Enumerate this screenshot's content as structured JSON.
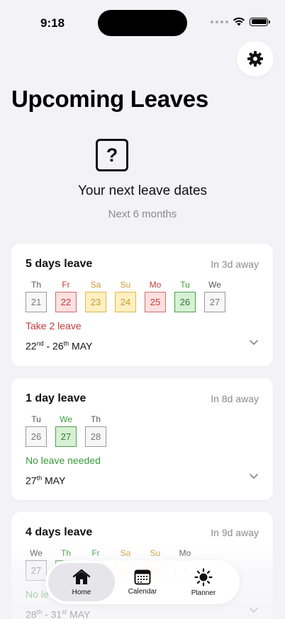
{
  "status": {
    "time": "9:18"
  },
  "header": {
    "title": "Upcoming Leaves",
    "settings_icon": "gear-icon"
  },
  "hero": {
    "icon": "question-square-icon",
    "icon_glyph": "?",
    "title": "Your next leave dates",
    "subtitle": "Next 6 months"
  },
  "cards": [
    {
      "title": "5 days leave",
      "away": "In 3d away",
      "days": [
        {
          "name": "Th",
          "num": "21",
          "state": "normal"
        },
        {
          "name": "Fr",
          "num": "22",
          "state": "leave"
        },
        {
          "name": "Sa",
          "num": "23",
          "state": "weekend"
        },
        {
          "name": "Su",
          "num": "24",
          "state": "weekend"
        },
        {
          "name": "Mo",
          "num": "25",
          "state": "leave"
        },
        {
          "name": "Tu",
          "num": "26",
          "state": "holiday"
        },
        {
          "name": "We",
          "num": "27",
          "state": "normal"
        }
      ],
      "note": "Take 2 leave",
      "note_kind": "red",
      "range_start_day": "22",
      "range_start_suffix": "nd",
      "range_sep": " - ",
      "range_end_day": "26",
      "range_end_suffix": "th",
      "range_month": " MAY"
    },
    {
      "title": "1 day leave",
      "away": "In 8d away",
      "days": [
        {
          "name": "Tu",
          "num": "26",
          "state": "normal"
        },
        {
          "name": "We",
          "num": "27",
          "state": "holiday"
        },
        {
          "name": "Th",
          "num": "28",
          "state": "normal"
        }
      ],
      "note": "No leave needed",
      "note_kind": "green",
      "range_start_day": "27",
      "range_start_suffix": "th",
      "range_month": " MAY"
    },
    {
      "title": "4 days leave",
      "away": "In 9d away",
      "days": [
        {
          "name": "We",
          "num": "27",
          "state": "normal"
        },
        {
          "name": "Th",
          "num": "28",
          "state": "holiday"
        },
        {
          "name": "Fr",
          "num": "29",
          "state": "holiday"
        },
        {
          "name": "Sa",
          "num": "30",
          "state": "weekend"
        },
        {
          "name": "Su",
          "num": "31",
          "state": "weekend"
        },
        {
          "name": "Mo",
          "num": "1",
          "state": "normal"
        }
      ],
      "note": "No le",
      "note_kind": "green",
      "range_start_day": "28",
      "range_start_suffix": "th",
      "range_sep": " - ",
      "range_end_day": "31",
      "range_end_suffix": "st",
      "range_month": " MAY"
    }
  ],
  "tabbar": {
    "tabs": [
      {
        "label": "Home",
        "icon": "house-icon",
        "selected": true
      },
      {
        "label": "Calendar",
        "icon": "calendar-icon",
        "selected": false
      },
      {
        "label": "Planner",
        "icon": "sun-icon",
        "selected": false
      }
    ]
  },
  "colors": {
    "background": "#f2f2f7",
    "leave": "#c43a3a",
    "weekend": "#c99a2e",
    "holiday": "#3a9a3a"
  }
}
